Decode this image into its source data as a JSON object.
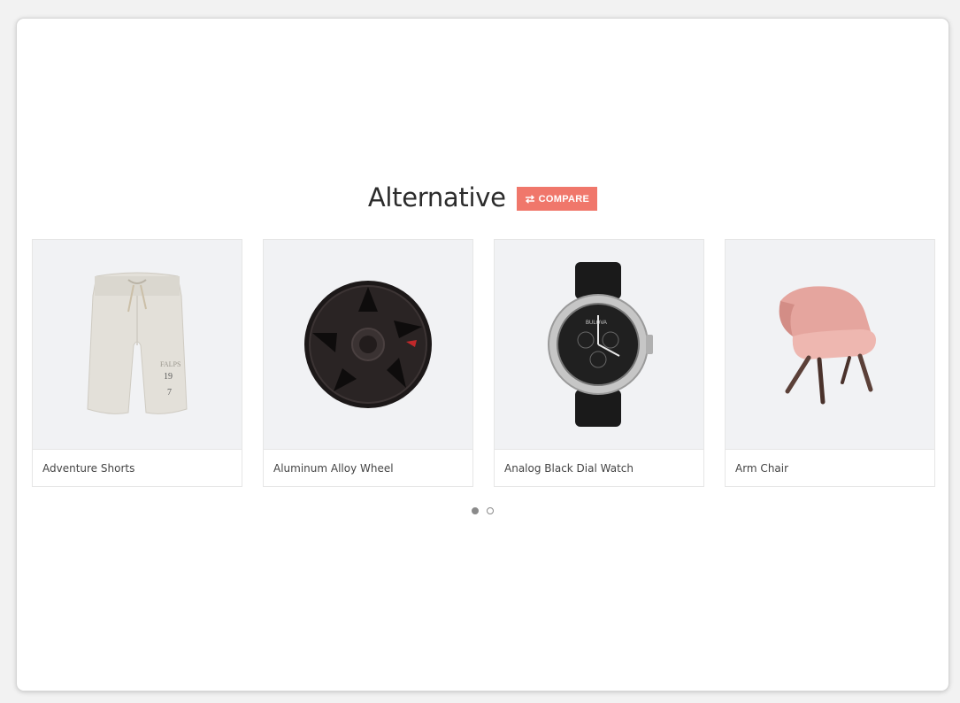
{
  "section": {
    "title": "Alternative",
    "compare_label": "COMPARE",
    "compare_icon": "swap-arrows-icon"
  },
  "products": [
    {
      "name": "Adventure Shorts",
      "icon": "shorts-image"
    },
    {
      "name": "Aluminum Alloy Wheel",
      "icon": "wheel-image"
    },
    {
      "name": "Analog Black Dial Watch",
      "icon": "watch-image"
    },
    {
      "name": "Arm Chair",
      "icon": "chair-image"
    }
  ],
  "carousel": {
    "pages": 2,
    "active_page": 1
  },
  "colors": {
    "accent": "#f0776b",
    "card_image_bg": "#f1f2f4"
  }
}
